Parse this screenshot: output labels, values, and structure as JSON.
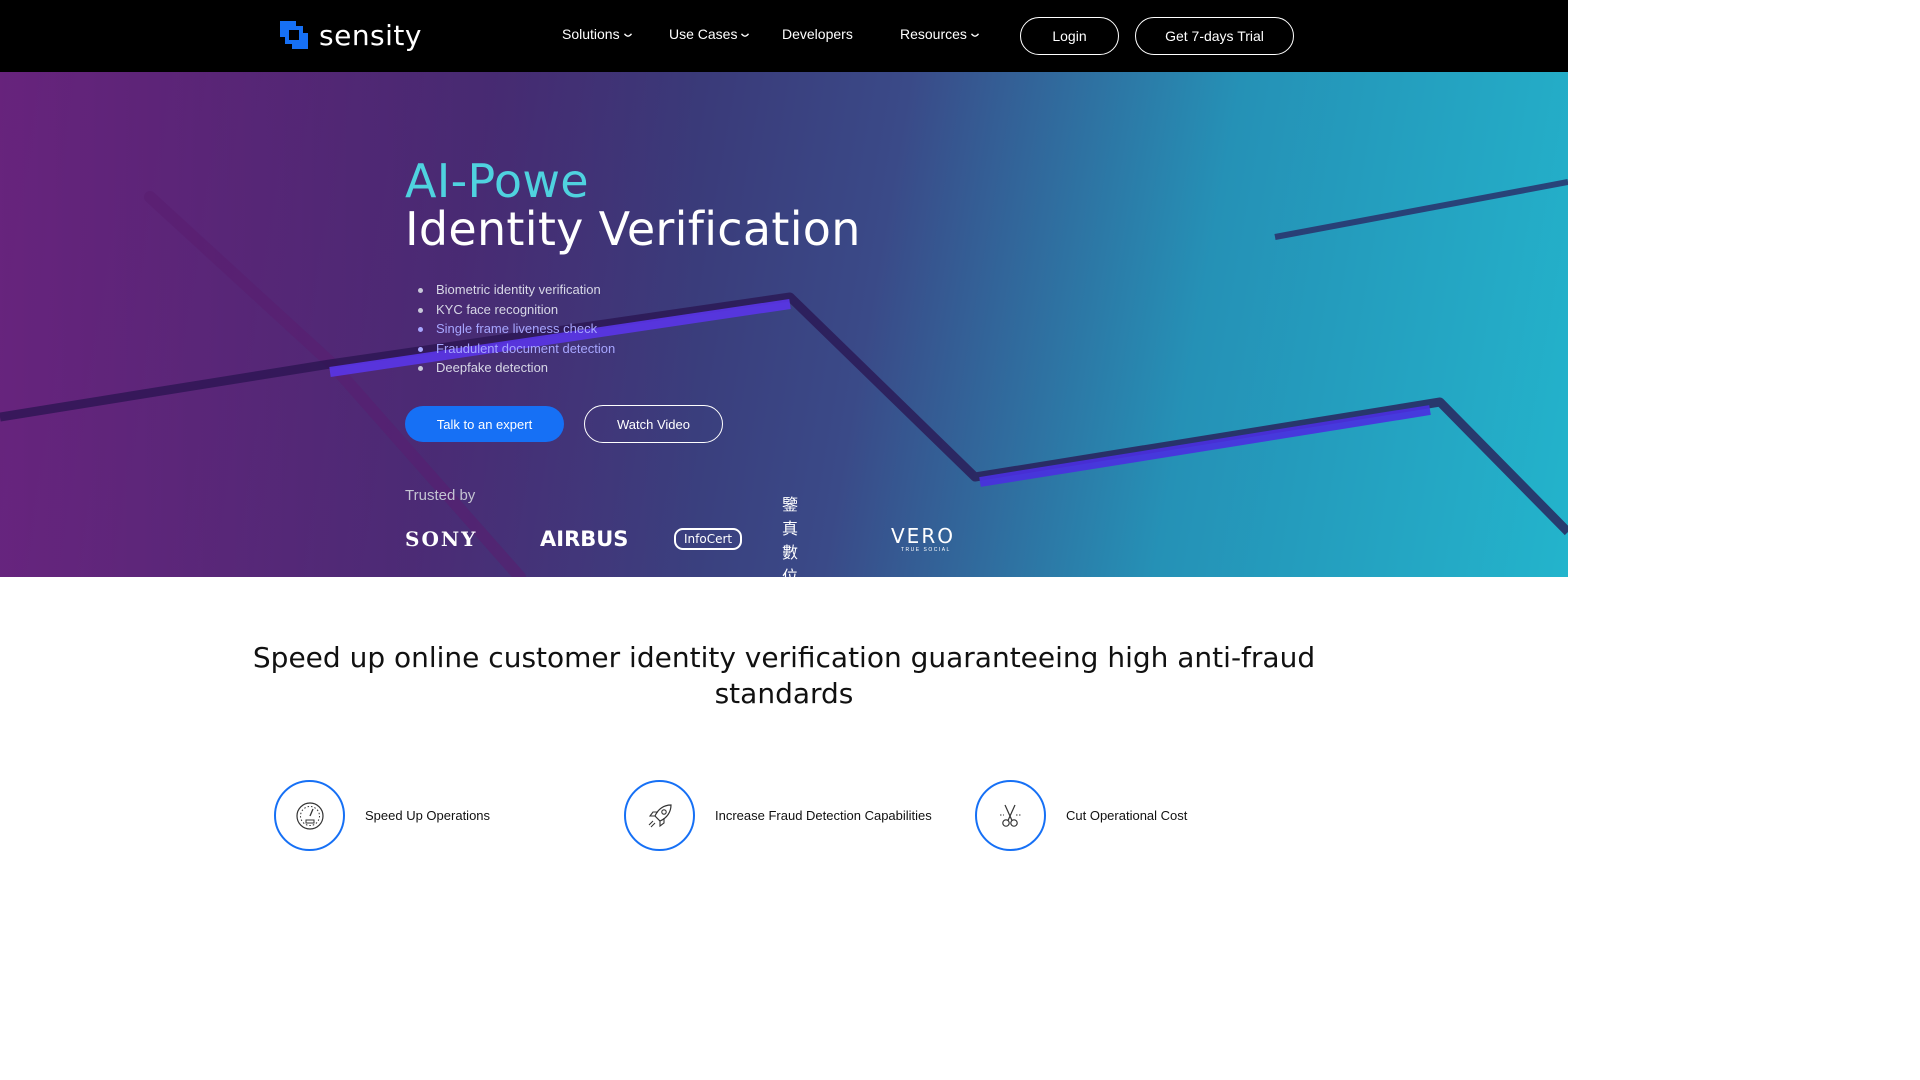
{
  "nav": {
    "logo_text": "sensity",
    "items": [
      {
        "label": "Solutions",
        "has_dropdown": true
      },
      {
        "label": "Use Cases",
        "has_dropdown": true
      },
      {
        "label": "Developers",
        "has_dropdown": false
      },
      {
        "label": "Resources",
        "has_dropdown": true
      }
    ],
    "login_label": "Login",
    "trial_label": "Get 7-days Trial"
  },
  "hero": {
    "title_line1": "AI-Powe",
    "title_line2": "Identity Verification",
    "features": [
      "Biometric identity verification",
      "KYC face recognition",
      "Single frame liveness check",
      "Fraudulent document detection",
      "Deepfake detection"
    ],
    "cta_primary": "Talk to an expert",
    "cta_secondary": "Watch Video",
    "trusted_label": "Trusted by",
    "brands": {
      "sony": "SONY",
      "airbus": "AIRBUS",
      "infocert": "InfoCert",
      "cn": "鑒真數位",
      "vero": "VERO",
      "vero_sub": "TRUE SOCIAL"
    }
  },
  "section": {
    "headline_line1": "Speed up online customer identity verification guaranteeing high anti-fraud",
    "headline_line2": "standards",
    "benefits": [
      {
        "label": "Speed Up Operations",
        "icon": "speedometer-icon"
      },
      {
        "label": "Increase Fraud Detection Capabilities",
        "icon": "rocket-icon"
      },
      {
        "label": "Cut Operational Cost",
        "icon": "scissors-icon"
      }
    ]
  },
  "colors": {
    "accent_blue": "#1670f5",
    "title_cyan": "#4fd2df",
    "nav_bg": "#000000"
  }
}
